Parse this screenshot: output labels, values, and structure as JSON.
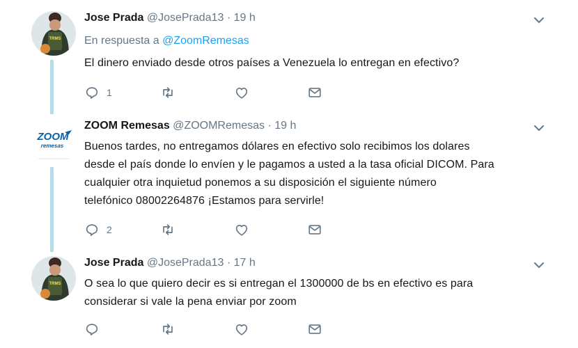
{
  "tweets": [
    {
      "name": "Jose Prada",
      "handle": "@JosePrada13",
      "dot": "·",
      "time": "19 h",
      "reply_prefix": "En respuesta a",
      "reply_mention": "@ZoomRemesas",
      "text": "El dinero enviado desde otros países a Venezuela lo entregan en efectivo?",
      "reply_count": "1",
      "retweet_count": "",
      "like_count": ""
    },
    {
      "name": "ZOOM Remesas",
      "handle": "@ZOOMRemesas",
      "dot": "·",
      "time": "19 h",
      "logo_top": "ZOOM",
      "logo_bottom": "remesas",
      "text_lines": [
        "Buenos tardes, no entregamos dólares en efectivo solo recibimos los dolares",
        "desde el país donde lo envíen y le pagamos a usted a la tasa oficial DICOM. Para",
        "cualquier otra inquietud ponemos a su disposición el siguiente número",
        "telefónico 08002264876 ¡Estamos para servirle!"
      ],
      "reply_count": "2",
      "retweet_count": "",
      "like_count": ""
    },
    {
      "name": "Jose Prada",
      "handle": "@JosePrada13",
      "dot": "·",
      "time": "17 h",
      "text_lines": [
        "O sea lo que quiero decir es si entregan el 1300000 de bs en efectivo es para",
        "considerar si vale la pena enviar por zoom"
      ],
      "reply_count": "",
      "retweet_count": "",
      "like_count": ""
    }
  ],
  "colors": {
    "accent": "#1da1f2",
    "muted": "#657786",
    "thread_line": "#b8dbe8",
    "logo_blue": "#0b5fa8"
  },
  "icons": [
    "reply-icon",
    "retweet-icon",
    "like-icon",
    "message-icon",
    "chevron-down-icon"
  ]
}
